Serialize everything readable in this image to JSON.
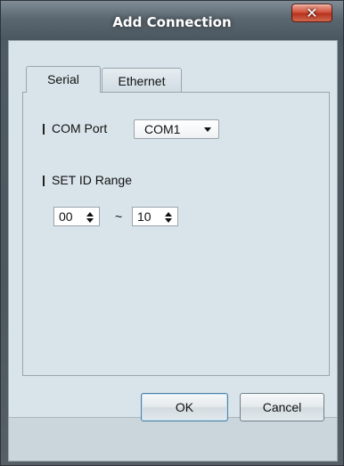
{
  "window": {
    "title": "Add Connection",
    "close_glyph": "✕"
  },
  "tabs": [
    {
      "label": "Serial",
      "selected": true
    },
    {
      "label": "Ethernet",
      "selected": false
    }
  ],
  "serial": {
    "com_port": {
      "label": "COM Port",
      "value": "COM1"
    },
    "set_id_range": {
      "label": "SET ID Range",
      "from": "00",
      "separator": "~",
      "to": "10"
    }
  },
  "buttons": {
    "ok": "OK",
    "cancel": "Cancel"
  },
  "icons": {
    "close": "close-icon",
    "dropdown": "chevron-down-icon",
    "spin_up": "spin-up-icon",
    "spin_down": "spin-down-icon"
  }
}
